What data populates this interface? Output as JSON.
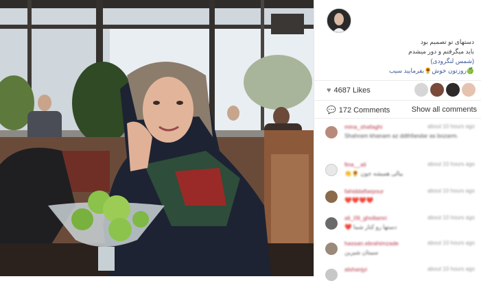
{
  "colors": {
    "username_red": "#b8374a",
    "muted_gray": "#9a9a9a",
    "caption_blue": "#3a5a94",
    "panel_border": "#e6e6e6"
  },
  "post": {
    "caption_lines": [
      "دستهای تو تصمیم بود",
      "باید میگرفتم و دور میشدم",
      "(شمس لنگرودی)",
      "🍏روزتون خوش🌻بفرمایید سیب"
    ],
    "likes_count": "4687 Likes",
    "comments_count": "172 Comments",
    "show_all_label": "Show all comments"
  },
  "icons": {
    "heart": "heart-icon",
    "comment": "comment-bubble-icon"
  },
  "comments": [
    {
      "user": "mina_shafaghi",
      "time": "about 10 hours ago",
      "text": "Shahram khanam az ddthfandar as bozarm."
    },
    {
      "user": "fina__ali",
      "time": "about 10 hours ago",
      "text": "👏🌻 بیالی همیشه جون"
    },
    {
      "user": "fahiddaftarpour",
      "time": "about 10 hours ago",
      "text": "❤️❤️❤️❤️"
    },
    {
      "user": "ali_09_ghollamri",
      "time": "about 10 hours ago",
      "text": "❤️ دستها رو کنار شما"
    },
    {
      "user": "hassan.ebrahimzade",
      "time": "about 10 hours ago",
      "text": "سیبتان شیرین"
    },
    {
      "user": "alshanjyi",
      "time": "about 10 hours ago",
      "text": ""
    }
  ]
}
